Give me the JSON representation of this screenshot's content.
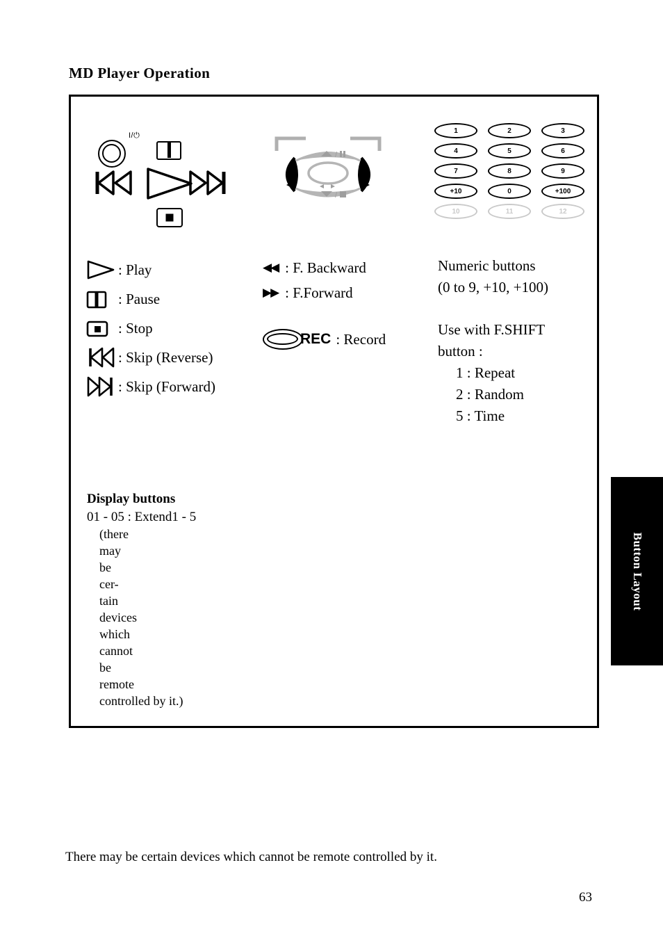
{
  "page": {
    "title": "MD Player Operation",
    "side_tab_label": "Button Layout",
    "footer_note": "There may be certain devices which cannot be remote controlled by it.",
    "page_number": "63"
  },
  "diagram": {
    "power_label": "I/⏻",
    "power_icon": "power-circle-icon",
    "pause_icon": "pause-icon",
    "play_icon": "play-icon",
    "stop_icon": "stop-icon",
    "skip_reverse_icon": "skip-reverse-icon",
    "skip_forward_icon": "skip-forward-icon",
    "dpad": {
      "up_label": "▲/❙❙",
      "down_label": "▼/■",
      "left_icon": "dpad-left-icon",
      "right_icon": "dpad-right-icon",
      "center_icon": "dpad-center-icon"
    }
  },
  "keypad": {
    "rows": [
      [
        "1",
        "2",
        "3"
      ],
      [
        "4",
        "5",
        "6"
      ],
      [
        "7",
        "8",
        "9"
      ],
      [
        "+10",
        "0",
        "+100"
      ]
    ],
    "disabled_row": [
      "10",
      "11",
      "12"
    ]
  },
  "legend_left": [
    {
      "icon": "play-icon",
      "text": ": Play"
    },
    {
      "icon": "pause-icon",
      "text": ": Pause"
    },
    {
      "icon": "stop-icon",
      "text": ": Stop"
    },
    {
      "icon": "skip-reverse-icon",
      "text": ": Skip (Reverse)"
    },
    {
      "icon": "skip-forward-icon",
      "text": ": Skip (Forward)"
    }
  ],
  "legend_mid": {
    "rows": [
      {
        "symbol": "◀◀",
        "text": ": F. Backward"
      },
      {
        "symbol": "▶▶",
        "text": ": F.Forward"
      }
    ],
    "record": {
      "icon": "record-ellipse-icon",
      "word": "REC",
      "text": ": Record"
    }
  },
  "legend_right": {
    "line1": "Numeric buttons",
    "line2": "(0 to 9, +10, +100)",
    "line3": "Use with F.SHIFT",
    "line4": "button :",
    "shift_items": [
      "1 :  Repeat",
      "2 :  Random",
      "5 :  Time"
    ]
  },
  "display_buttons": {
    "title": "Display buttons",
    "line": "01 - 05 : Extend1 - 5",
    "note_lines": [
      [
        "(there",
        "may",
        "be",
        "cer-"
      ],
      [
        "tain",
        "devices",
        "which"
      ],
      [
        "cannot",
        "be",
        "remote"
      ],
      [
        "controlled by it.)"
      ]
    ]
  }
}
